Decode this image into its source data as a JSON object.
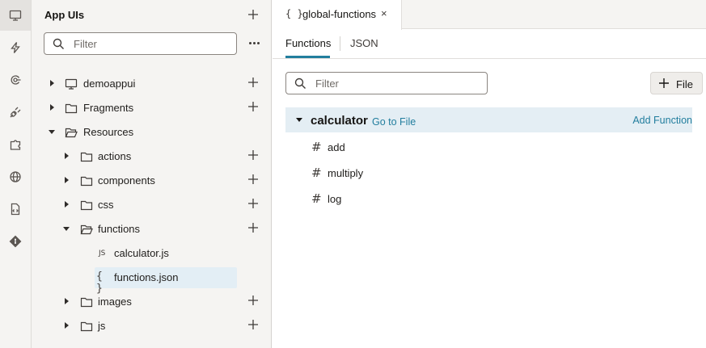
{
  "rail": {
    "items": [
      {
        "icon": "monitor-icon",
        "active": true
      },
      {
        "icon": "lightning-icon"
      },
      {
        "icon": "service-icon"
      },
      {
        "icon": "plug-icon"
      },
      {
        "icon": "component-icon"
      },
      {
        "icon": "globe-icon"
      },
      {
        "icon": "source-icon"
      },
      {
        "icon": "git-icon"
      }
    ]
  },
  "navigator": {
    "title": "App UIs",
    "filter_placeholder": "Filter",
    "tree": [
      {
        "label": "demoappui",
        "icon": "monitor-icon",
        "expanded": false
      },
      {
        "label": "Fragments",
        "icon": "folder-icon",
        "expanded": false
      },
      {
        "label": "Resources",
        "icon": "folder-open-icon",
        "expanded": true
      },
      {
        "label": "actions",
        "icon": "folder-icon",
        "expanded": false
      },
      {
        "label": "components",
        "icon": "folder-icon",
        "expanded": false
      },
      {
        "label": "css",
        "icon": "folder-icon",
        "expanded": false
      },
      {
        "label": "functions",
        "icon": "folder-open-icon",
        "expanded": true
      },
      {
        "label": "calculator.js",
        "icon": "js-file-icon"
      },
      {
        "label": "functions.json",
        "icon": "json-file-icon",
        "selected": true
      },
      {
        "label": "images",
        "icon": "folder-icon",
        "expanded": false
      },
      {
        "label": "js",
        "icon": "folder-icon",
        "expanded": false
      }
    ],
    "js_badge": "JS",
    "json_badge": "{ }"
  },
  "editor": {
    "file_tab": {
      "icon": "{ }",
      "title": "global-functions",
      "close": "×"
    },
    "subtabs": [
      "Functions",
      "JSON"
    ],
    "active_subtab": "Functions",
    "filter_placeholder": "Filter",
    "file_button": "File",
    "group": {
      "name": "calculator",
      "goto_link": "Go to File",
      "add_link": "Add Function",
      "functions": [
        "add",
        "multiply",
        "log"
      ],
      "function_icon": "#"
    }
  },
  "colors": {
    "accent": "#227e9e",
    "selection": "#e3eef5",
    "panel": "#f5f4f2"
  }
}
